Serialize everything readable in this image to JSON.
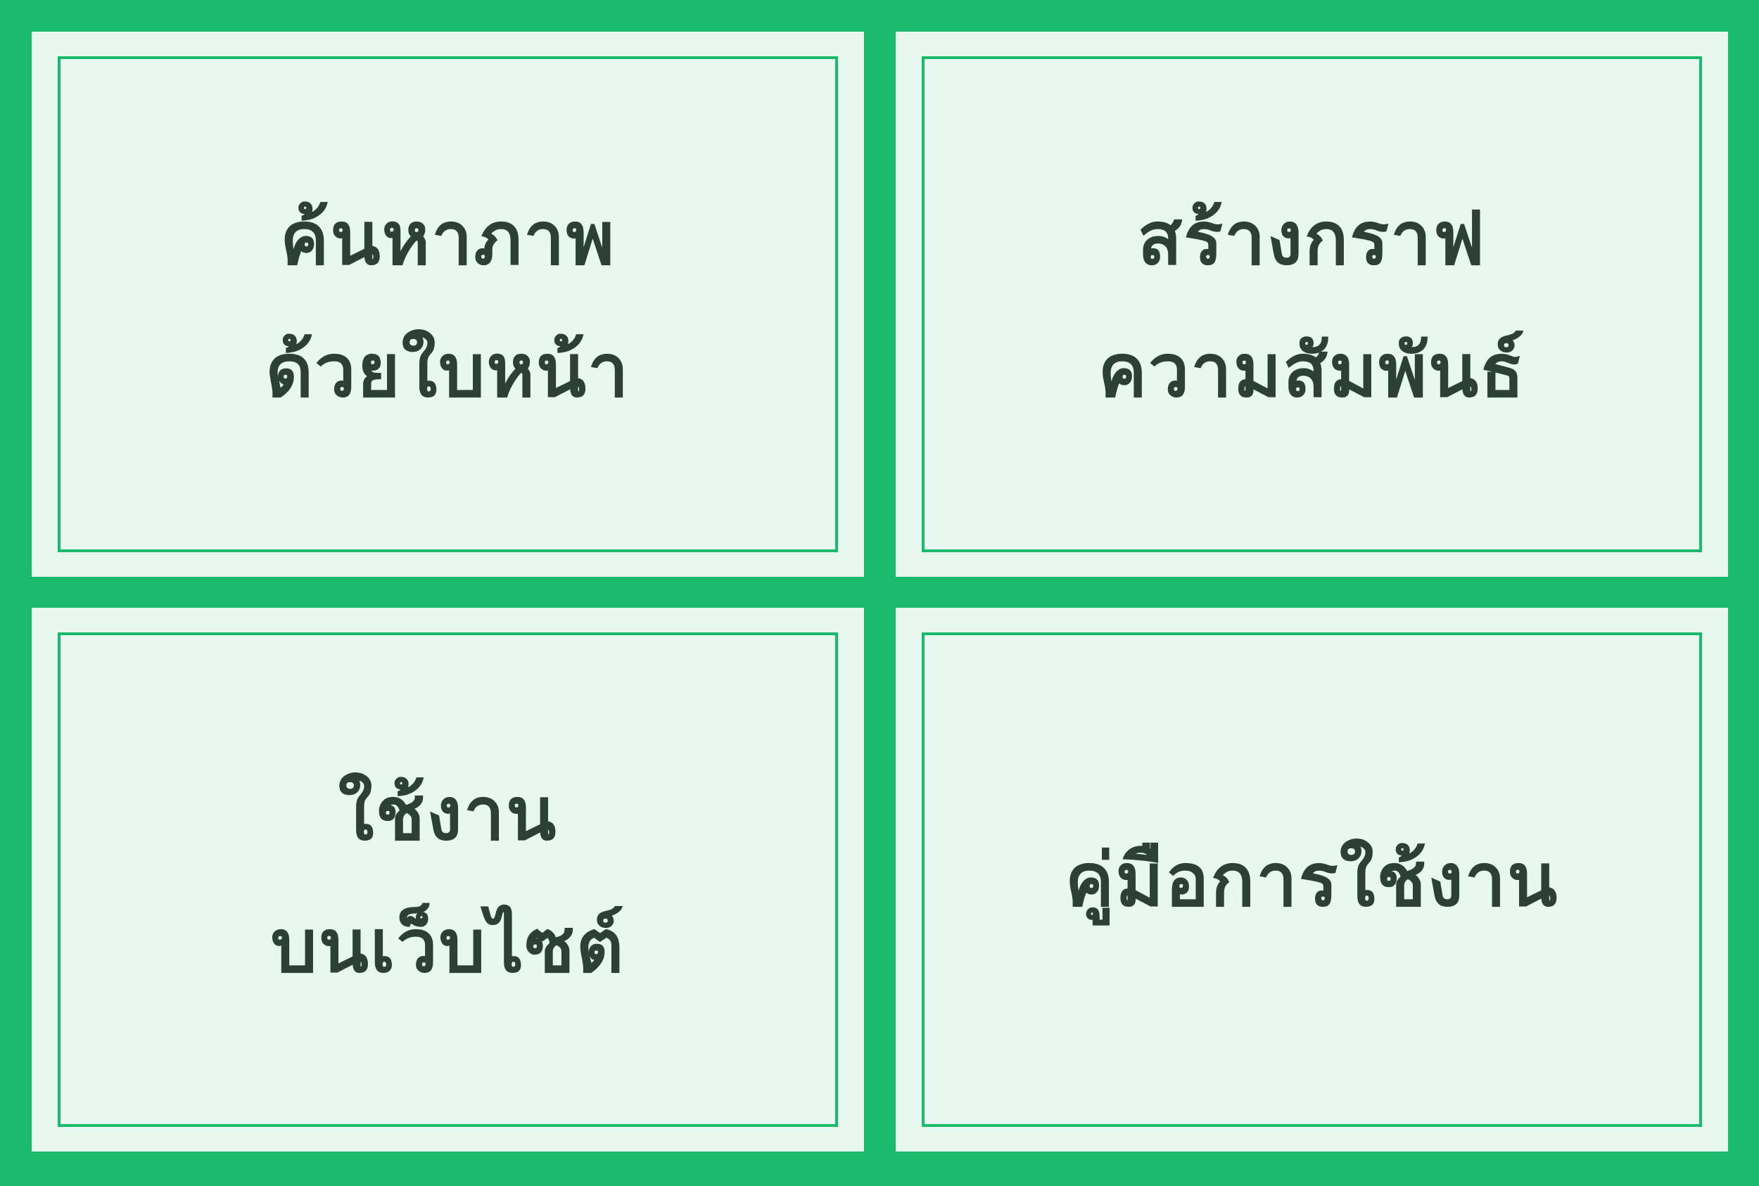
{
  "colors": {
    "background": "#19BA6C",
    "card_fill": "#E8F7F0",
    "card_border": "#19BA6C",
    "text": "#2C4035"
  },
  "menu": {
    "cards": [
      {
        "lines": [
          "ค้นหาภาพ",
          "ด้วยใบหน้า"
        ]
      },
      {
        "lines": [
          "สร้างกราฟ",
          "ความสัมพันธ์"
        ]
      },
      {
        "lines": [
          "ใช้งาน",
          "บนเว็บไซต์"
        ]
      },
      {
        "lines": [
          "คู่มือการใช้งาน"
        ]
      }
    ]
  }
}
